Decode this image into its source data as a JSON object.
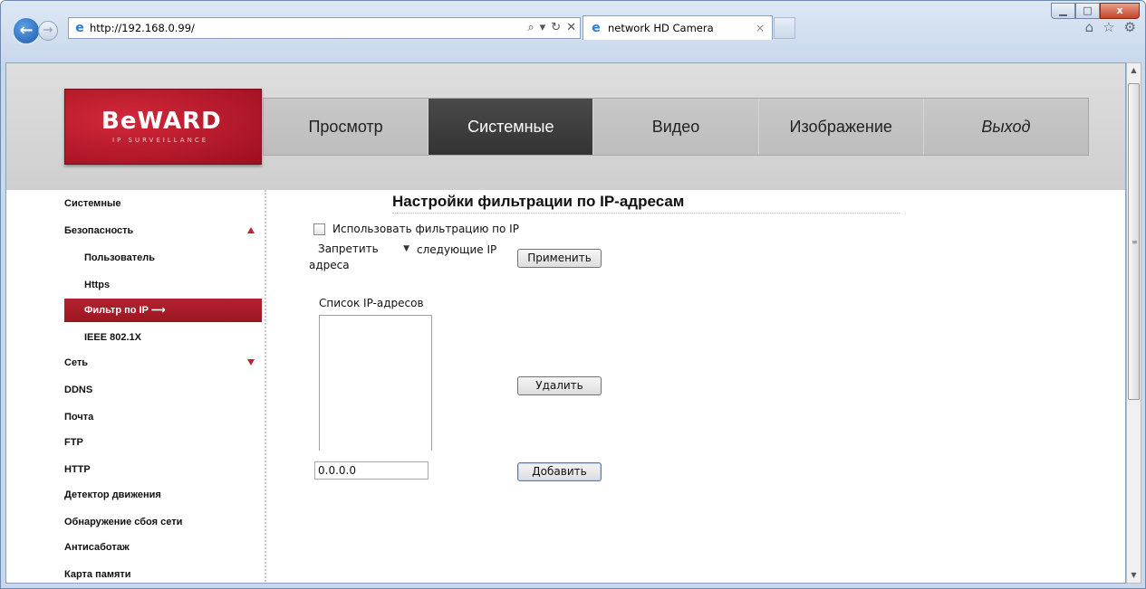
{
  "browser": {
    "url": "http://192.168.0.99/",
    "tab_title": "network HD Camera",
    "tab_close": "×",
    "window_buttons": {
      "minimize": "▁",
      "maximize": "□",
      "close": "x"
    },
    "back": "←",
    "forward": "→",
    "address_tools": {
      "search": "⌕",
      "compat": "▾",
      "refresh": "↻",
      "stop": "✕"
    },
    "toolbar_icons": {
      "home": "⌂",
      "favorites": "☆",
      "tools": "⚙"
    }
  },
  "logo": {
    "text": "BeWARD",
    "subtitle": "IP SURVEILLANCE"
  },
  "menu": [
    {
      "label": "Просмотр",
      "active": false
    },
    {
      "label": "Системные",
      "active": true
    },
    {
      "label": "Видео",
      "active": false
    },
    {
      "label": "Изображение",
      "active": false
    },
    {
      "label": "Выход",
      "active": false
    }
  ],
  "sidebar": [
    {
      "label": "Системные",
      "sub": false
    },
    {
      "label": "Безопасность",
      "sub": false,
      "arrow": "up"
    },
    {
      "label": "Пользователь",
      "sub": true
    },
    {
      "label": "Https",
      "sub": true
    },
    {
      "label": "Фильтр по IP",
      "sub": true,
      "active": true,
      "suffix": "⟶"
    },
    {
      "label": "IEEE 802.1X",
      "sub": true
    },
    {
      "label": "Сеть",
      "sub": false,
      "arrow": "down"
    },
    {
      "label": "DDNS",
      "sub": false
    },
    {
      "label": "Почта",
      "sub": false
    },
    {
      "label": "FTP",
      "sub": false
    },
    {
      "label": "HTTP",
      "sub": false
    },
    {
      "label": "Детектор движения",
      "sub": false
    },
    {
      "label": "Обнаружение сбоя сети",
      "sub": false
    },
    {
      "label": "Антисаботаж",
      "sub": false
    },
    {
      "label": "Карта памяти",
      "sub": false
    }
  ],
  "content": {
    "title": "Настройки фильтрации по IP-адресам",
    "checkbox_label": "Использовать фильтрацию по IP",
    "checkbox_checked": false,
    "select_value": "Запретить",
    "select_caret": "▼",
    "select_suffix_line1": "следующие IP",
    "select_suffix_line2": "адреса",
    "apply_button": "Применить",
    "list_label": "Список IP-адресов",
    "ip_list": [],
    "delete_button": "Удалить",
    "ip_input_value": "0.0.0.0",
    "add_button": "Добавить"
  },
  "colors": {
    "brand_red": "#b5212f",
    "active_menu": "#3a3a3a",
    "header_gray": "#d4d4d4"
  }
}
